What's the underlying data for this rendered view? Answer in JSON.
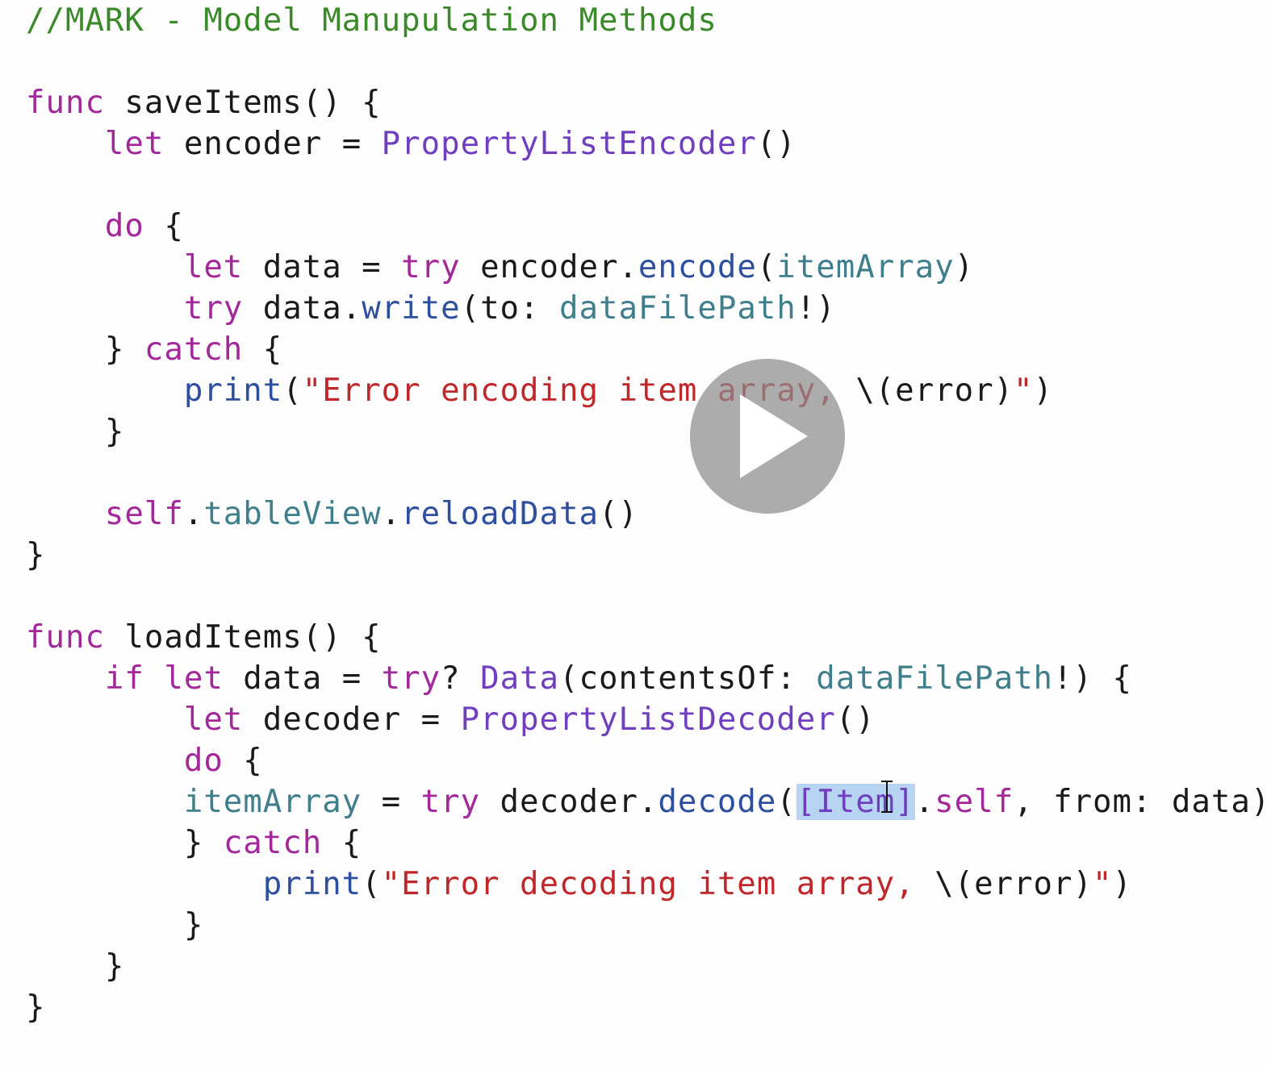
{
  "editor": {
    "lines": [
      [
        {
          "text": "//MARK - Model Manupulation Methods",
          "kind": "comment"
        }
      ],
      [],
      [
        {
          "text": "func",
          "kind": "keyword"
        },
        {
          "text": " saveItems() {",
          "kind": "plain"
        }
      ],
      [
        {
          "text": "    ",
          "kind": "plain"
        },
        {
          "text": "let",
          "kind": "keyword"
        },
        {
          "text": " encoder = ",
          "kind": "plain"
        },
        {
          "text": "PropertyListEncoder",
          "kind": "type"
        },
        {
          "text": "()",
          "kind": "plain"
        }
      ],
      [],
      [
        {
          "text": "    ",
          "kind": "plain"
        },
        {
          "text": "do",
          "kind": "keyword"
        },
        {
          "text": " {",
          "kind": "plain"
        }
      ],
      [
        {
          "text": "        ",
          "kind": "plain"
        },
        {
          "text": "let",
          "kind": "keyword"
        },
        {
          "text": " data = ",
          "kind": "plain"
        },
        {
          "text": "try",
          "kind": "keyword"
        },
        {
          "text": " encoder.",
          "kind": "plain"
        },
        {
          "text": "encode",
          "kind": "method"
        },
        {
          "text": "(",
          "kind": "plain"
        },
        {
          "text": "itemArray",
          "kind": "prop"
        },
        {
          "text": ")",
          "kind": "plain"
        }
      ],
      [
        {
          "text": "        ",
          "kind": "plain"
        },
        {
          "text": "try",
          "kind": "keyword"
        },
        {
          "text": " data.",
          "kind": "plain"
        },
        {
          "text": "write",
          "kind": "method"
        },
        {
          "text": "(to: ",
          "kind": "plain"
        },
        {
          "text": "dataFilePath",
          "kind": "prop"
        },
        {
          "text": "!)",
          "kind": "plain"
        }
      ],
      [
        {
          "text": "    } ",
          "kind": "plain"
        },
        {
          "text": "catch",
          "kind": "keyword"
        },
        {
          "text": " {",
          "kind": "plain"
        }
      ],
      [
        {
          "text": "        ",
          "kind": "plain"
        },
        {
          "text": "print",
          "kind": "method"
        },
        {
          "text": "(",
          "kind": "plain"
        },
        {
          "text": "\"Error encoding item array, ",
          "kind": "string"
        },
        {
          "text": "\\(error)",
          "kind": "plain"
        },
        {
          "text": "\"",
          "kind": "string"
        },
        {
          "text": ")",
          "kind": "plain"
        }
      ],
      [
        {
          "text": "    }",
          "kind": "plain"
        }
      ],
      [],
      [
        {
          "text": "    ",
          "kind": "plain"
        },
        {
          "text": "self",
          "kind": "keyword"
        },
        {
          "text": ".",
          "kind": "plain"
        },
        {
          "text": "tableView",
          "kind": "prop"
        },
        {
          "text": ".",
          "kind": "plain"
        },
        {
          "text": "reloadData",
          "kind": "method"
        },
        {
          "text": "()",
          "kind": "plain"
        }
      ],
      [
        {
          "text": "}",
          "kind": "plain"
        }
      ],
      [],
      [
        {
          "text": "func",
          "kind": "keyword"
        },
        {
          "text": " loadItems() {",
          "kind": "plain"
        }
      ],
      [
        {
          "text": "    ",
          "kind": "plain"
        },
        {
          "text": "if",
          "kind": "keyword"
        },
        {
          "text": " ",
          "kind": "plain"
        },
        {
          "text": "let",
          "kind": "keyword"
        },
        {
          "text": " data = ",
          "kind": "plain"
        },
        {
          "text": "try",
          "kind": "keyword"
        },
        {
          "text": "? ",
          "kind": "plain"
        },
        {
          "text": "Data",
          "kind": "type"
        },
        {
          "text": "(contentsOf: ",
          "kind": "plain"
        },
        {
          "text": "dataFilePath",
          "kind": "prop"
        },
        {
          "text": "!) {",
          "kind": "plain"
        }
      ],
      [
        {
          "text": "        ",
          "kind": "plain"
        },
        {
          "text": "let",
          "kind": "keyword"
        },
        {
          "text": " decoder = ",
          "kind": "plain"
        },
        {
          "text": "PropertyListDecoder",
          "kind": "type"
        },
        {
          "text": "()",
          "kind": "plain"
        }
      ],
      [
        {
          "text": "        ",
          "kind": "plain"
        },
        {
          "text": "do",
          "kind": "keyword"
        },
        {
          "text": " {",
          "kind": "plain"
        }
      ],
      [
        {
          "text": "        ",
          "kind": "plain"
        },
        {
          "text": "itemArray",
          "kind": "prop"
        },
        {
          "text": " = ",
          "kind": "plain"
        },
        {
          "text": "try",
          "kind": "keyword"
        },
        {
          "text": " decoder.",
          "kind": "plain"
        },
        {
          "text": "decode",
          "kind": "method"
        },
        {
          "text": "(",
          "kind": "plain"
        },
        {
          "text": "[Item]",
          "kind": "type",
          "selected": true
        },
        {
          "text": ".",
          "kind": "plain"
        },
        {
          "text": "self",
          "kind": "keyword"
        },
        {
          "text": ", from: data)",
          "kind": "plain"
        }
      ],
      [
        {
          "text": "        } ",
          "kind": "plain"
        },
        {
          "text": "catch",
          "kind": "keyword"
        },
        {
          "text": " {",
          "kind": "plain"
        }
      ],
      [
        {
          "text": "            ",
          "kind": "plain"
        },
        {
          "text": "print",
          "kind": "method"
        },
        {
          "text": "(",
          "kind": "plain"
        },
        {
          "text": "\"Error decoding item array, ",
          "kind": "string"
        },
        {
          "text": "\\(error)",
          "kind": "plain"
        },
        {
          "text": "\"",
          "kind": "string"
        },
        {
          "text": ")",
          "kind": "plain"
        }
      ],
      [
        {
          "text": "        }",
          "kind": "plain"
        }
      ],
      [
        {
          "text": "    }",
          "kind": "plain"
        }
      ],
      [
        {
          "text": "}",
          "kind": "plain"
        }
      ]
    ]
  },
  "overlay": {
    "play_button_icon": "play-icon",
    "cursor_icon": "text-cursor-icon"
  }
}
